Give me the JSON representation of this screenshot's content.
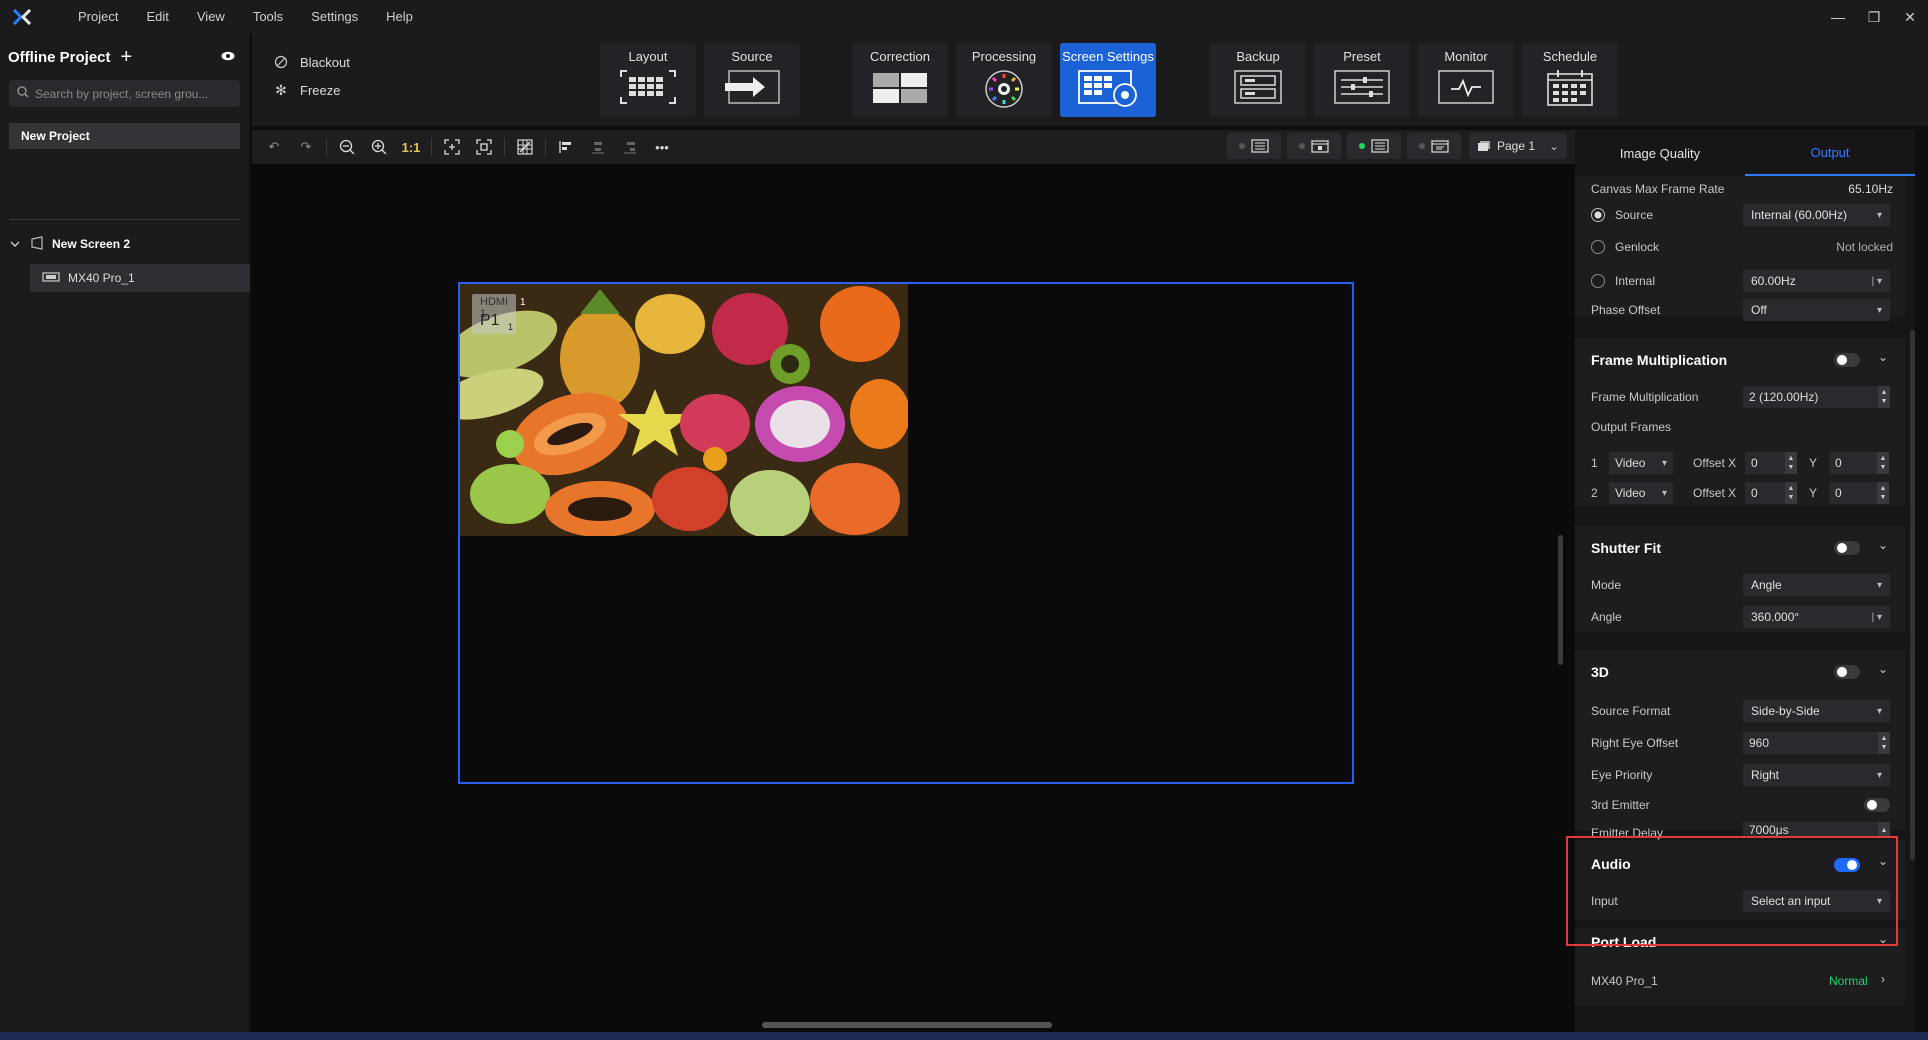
{
  "menubar": {
    "items": [
      "Project",
      "Edit",
      "View",
      "Tools",
      "Settings",
      "Help"
    ]
  },
  "sidebar": {
    "title": "Offline Project",
    "search_placeholder": "Search by project, screen grou...",
    "new_project": "New Project",
    "screen": "New Screen 2",
    "device": "MX40 Pro_1"
  },
  "quick_actions": {
    "blackout": "Blackout",
    "freeze": "Freeze"
  },
  "toolbar": {
    "layout": "Layout",
    "source": "Source",
    "correction": "Correction",
    "processing": "Processing",
    "screen_settings": "Screen Settings",
    "backup": "Backup",
    "preset": "Preset",
    "monitor": "Monitor",
    "schedule": "Schedule"
  },
  "subtoolbar": {
    "one_to_one": "1:1",
    "more": "•••",
    "page": "Page 1"
  },
  "canvas": {
    "layer_source": "HDMI 1",
    "layer_id": "P1",
    "layer_sub": "1",
    "layer_num": "1"
  },
  "panel": {
    "tabs": [
      "Image Quality",
      "Output"
    ],
    "active_tab": "Output",
    "canvas_max_frame_rate_label": "Canvas Max Frame Rate",
    "canvas_max_frame_rate_value": "65.10Hz",
    "source_label": "Source",
    "source_value": "Internal (60.00Hz)",
    "genlock_label": "Genlock",
    "genlock_value": "Not locked",
    "internal_label": "Internal",
    "internal_value": "60.00Hz",
    "phase_offset_label": "Phase Offset",
    "phase_offset_value": "Off",
    "frame_mult": {
      "title": "Frame Multiplication",
      "enabled": false,
      "mult_label": "Frame Multiplication",
      "mult_value": "2 (120.00Hz)",
      "output_frames_label": "Output Frames",
      "frames": [
        {
          "index": "1",
          "type": "Video",
          "offset_x_label": "Offset X",
          "x": "0",
          "y_label": "Y",
          "y": "0"
        },
        {
          "index": "2",
          "type": "Video",
          "offset_x_label": "Offset X",
          "x": "0",
          "y_label": "Y",
          "y": "0"
        }
      ]
    },
    "shutter_fit": {
      "title": "Shutter Fit",
      "enabled": false,
      "mode_label": "Mode",
      "mode_value": "Angle",
      "angle_label": "Angle",
      "angle_value": "360.000°"
    },
    "three_d": {
      "title": "3D",
      "enabled": false,
      "source_format_label": "Source Format",
      "source_format_value": "Side-by-Side",
      "right_eye_offset_label": "Right Eye Offset",
      "right_eye_offset_value": "960",
      "eye_priority_label": "Eye Priority",
      "eye_priority_value": "Right",
      "third_emitter_label": "3rd Emitter",
      "emitter_delay_label": "Emitter Delay",
      "emitter_delay_value": "7000μs"
    },
    "audio": {
      "title": "Audio",
      "enabled": true,
      "input_label": "Input",
      "input_value": "Select an input"
    },
    "port_load": {
      "title": "Port Load",
      "device": "MX40 Pro_1",
      "status": "Normal"
    }
  },
  "colors": {
    "accent": "#1a62d6",
    "highlight": "#e23a3a",
    "status_ok": "#2ecf6b"
  }
}
